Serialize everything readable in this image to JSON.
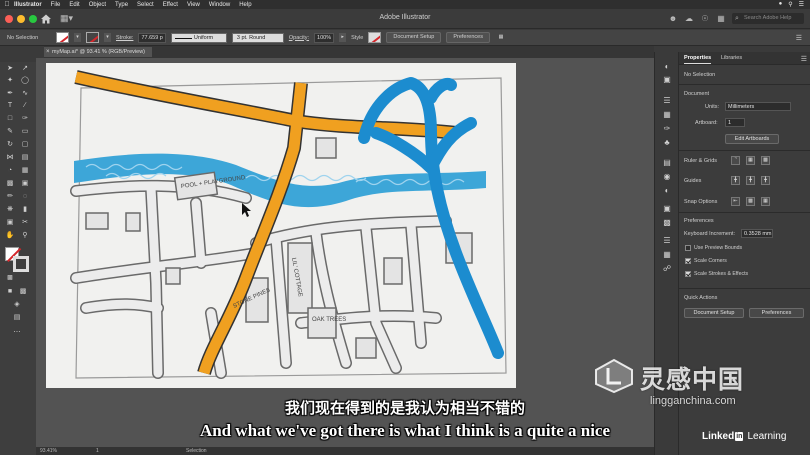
{
  "menubar": {
    "app": "Illustrator",
    "items": [
      "File",
      "Edit",
      "Object",
      "Type",
      "Select",
      "Effect",
      "View",
      "Window",
      "Help"
    ]
  },
  "window": {
    "title": "Adobe Illustrator",
    "search_placeholder": "Search Adobe Help"
  },
  "control_bar": {
    "selection": "No Selection",
    "stroke_label": "Stroke:",
    "stroke_weight": "77.659 p",
    "stroke_profile": "Uniform",
    "brush": "3 pt. Round",
    "opacity_label": "Opacity:",
    "opacity_value": "100%",
    "style_label": "Style",
    "document_setup": "Document Setup",
    "preferences": "Preferences"
  },
  "document": {
    "tab_title": "myMap.ai* @ 93.41 % (RGB/Preview)",
    "close": "×"
  },
  "status_bar": {
    "zoom": "93.41%",
    "artboard_num": "1",
    "tool": "Selection"
  },
  "properties_panel": {
    "tab_properties": "Properties",
    "tab_libraries": "Libraries",
    "selection": "No Selection",
    "document_header": "Document",
    "units_label": "Units:",
    "units_value": "Millimeters",
    "artboard_label": "Artboard:",
    "artboard_value": "1",
    "edit_artboards": "Edit Artboards",
    "rulers_grids": "Ruler & Grids",
    "guides": "Guides",
    "snap_options": "Snap Options",
    "preferences_header": "Preferences",
    "keyboard_increment_label": "Keyboard Increment:",
    "keyboard_increment_value": "0.3528 mm",
    "use_preview_bounds": "Use Preview Bounds",
    "scale_corners": "Scale Corners",
    "scale_strokes": "Scale Strokes & Effects",
    "quick_actions": "Quick Actions",
    "document_setup": "Document Setup",
    "preferences": "Preferences"
  },
  "map_sketch_labels": {
    "label_a": "POOL + PLAYGROUND",
    "label_b": "LIL' COTTAGE",
    "label_c": "STONE PINES",
    "label_d": "OAK TREES"
  },
  "subtitles": {
    "chinese": "我们现在得到的是我认为相当不错的",
    "english": "And what we've got there is what I think is a quite a nice"
  },
  "watermark": {
    "chinese": "灵感中国",
    "url": "lingganchina.com"
  },
  "linkedin": {
    "linked": "Linked",
    "in": "in",
    "learning": "Learning"
  },
  "colors": {
    "road_orange": "#f0a020",
    "highway_blue": "#1c8ccf",
    "river_blue": "#3da6d8",
    "canvas_bg": "#535353"
  }
}
